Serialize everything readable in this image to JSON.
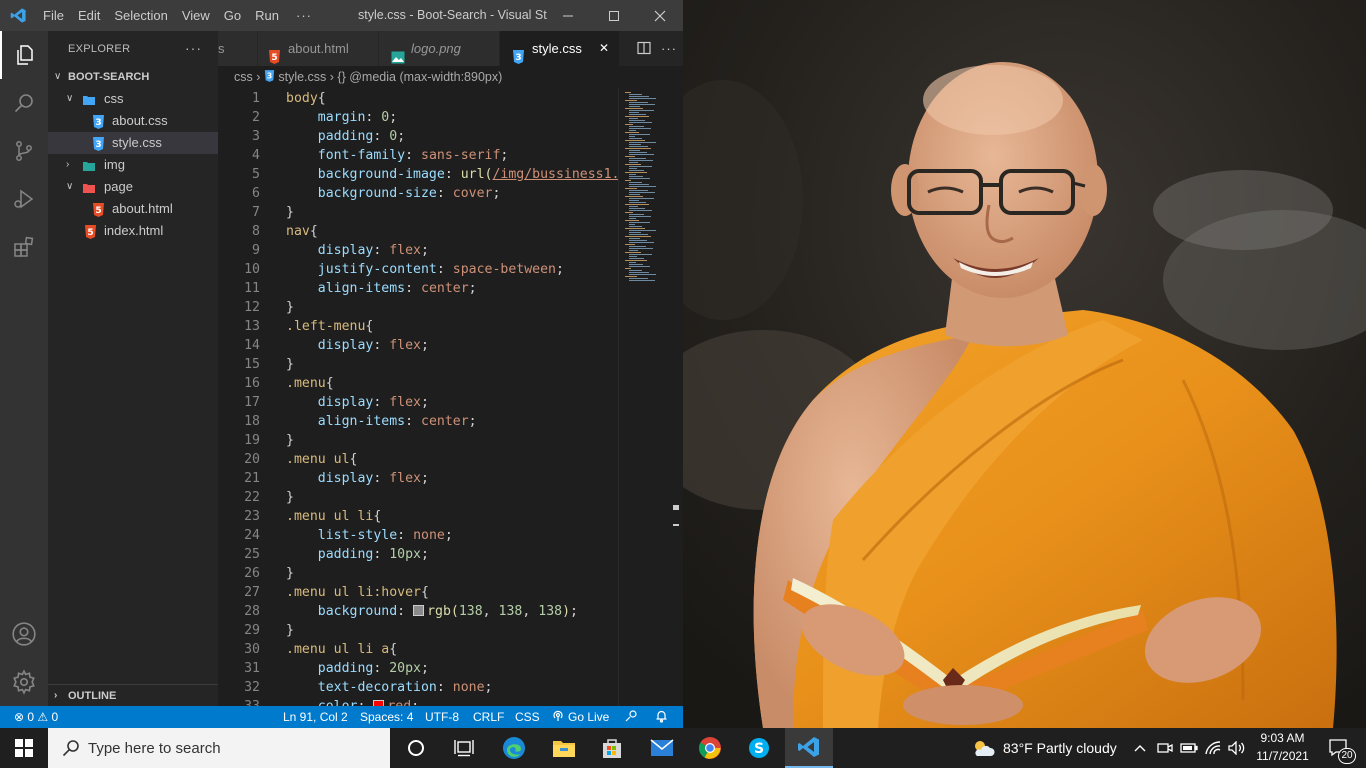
{
  "window": {
    "title": "style.css - Boot-Search - Visual St...",
    "menu": [
      "File",
      "Edit",
      "Selection",
      "View",
      "Go",
      "Run",
      "···"
    ]
  },
  "sidebar": {
    "header": "EXPLORER",
    "more": "···",
    "project": "BOOT-SEARCH",
    "tree": [
      {
        "label": "css",
        "type": "folder",
        "open": true
      },
      {
        "label": "about.css",
        "type": "css"
      },
      {
        "label": "style.css",
        "type": "css",
        "selected": true
      },
      {
        "label": "img",
        "type": "folder",
        "open": false
      },
      {
        "label": "page",
        "type": "folder",
        "open": true
      },
      {
        "label": "about.html",
        "type": "html"
      },
      {
        "label": "index.html",
        "type": "html"
      }
    ],
    "outline": "OUTLINE"
  },
  "tabs": [
    {
      "label": "s",
      "partial": true
    },
    {
      "label": "about.html",
      "icon": "html5-icon"
    },
    {
      "label": "logo.png",
      "icon": "image-icon",
      "italic": true
    },
    {
      "label": "style.css",
      "icon": "css3-icon",
      "active": true,
      "close": "✕"
    }
  ],
  "breadcrumb": {
    "folder": "css",
    "file": "style.css",
    "symbol": "{} @media (max-width:890px)"
  },
  "code_lines": [
    {
      "n": "1",
      "parts": [
        [
          "sel-t",
          "body"
        ],
        [
          "",
          "{"
        ]
      ]
    },
    {
      "n": "2",
      "parts": [
        [
          "",
          "    "
        ],
        [
          "prop",
          "margin"
        ],
        [
          "",
          ": "
        ],
        [
          "num",
          "0"
        ],
        [
          "",
          ";"
        ]
      ]
    },
    {
      "n": "3",
      "parts": [
        [
          "",
          "    "
        ],
        [
          "prop",
          "padding"
        ],
        [
          "",
          ": "
        ],
        [
          "num",
          "0"
        ],
        [
          "",
          ";"
        ]
      ]
    },
    {
      "n": "4",
      "parts": [
        [
          "",
          "    "
        ],
        [
          "prop",
          "font-family"
        ],
        [
          "",
          ": "
        ],
        [
          "val",
          "sans-serif"
        ],
        [
          "",
          ";"
        ]
      ]
    },
    {
      "n": "5",
      "parts": [
        [
          "",
          "    "
        ],
        [
          "prop",
          "background-image"
        ],
        [
          "",
          ": "
        ],
        [
          "fn",
          "url("
        ],
        [
          "url",
          "/img/bussiness1.j"
        ]
      ]
    },
    {
      "n": "6",
      "parts": [
        [
          "",
          "    "
        ],
        [
          "prop",
          "background-size"
        ],
        [
          "",
          ": "
        ],
        [
          "val",
          "cover"
        ],
        [
          "",
          ";"
        ]
      ]
    },
    {
      "n": "7",
      "parts": [
        [
          "",
          "}"
        ]
      ]
    },
    {
      "n": "8",
      "parts": [
        [
          "sel-t",
          "nav"
        ],
        [
          "",
          "{"
        ]
      ]
    },
    {
      "n": "9",
      "parts": [
        [
          "",
          "    "
        ],
        [
          "prop",
          "display"
        ],
        [
          "",
          ": "
        ],
        [
          "val",
          "flex"
        ],
        [
          "",
          ";"
        ]
      ]
    },
    {
      "n": "10",
      "parts": [
        [
          "",
          "    "
        ],
        [
          "prop",
          "justify-content"
        ],
        [
          "",
          ": "
        ],
        [
          "val",
          "space-between"
        ],
        [
          "",
          ";"
        ]
      ]
    },
    {
      "n": "11",
      "parts": [
        [
          "",
          "    "
        ],
        [
          "prop",
          "align-items"
        ],
        [
          "",
          ": "
        ],
        [
          "val",
          "center"
        ],
        [
          "",
          ";"
        ]
      ]
    },
    {
      "n": "12",
      "parts": [
        [
          "",
          "}"
        ]
      ]
    },
    {
      "n": "13",
      "parts": [
        [
          "sel-t",
          ".left-menu"
        ],
        [
          "",
          "{"
        ]
      ]
    },
    {
      "n": "14",
      "parts": [
        [
          "",
          "    "
        ],
        [
          "prop",
          "display"
        ],
        [
          "",
          ": "
        ],
        [
          "val",
          "flex"
        ],
        [
          "",
          ";"
        ]
      ]
    },
    {
      "n": "15",
      "parts": [
        [
          "",
          "}"
        ]
      ]
    },
    {
      "n": "16",
      "parts": [
        [
          "sel-t",
          ".menu"
        ],
        [
          "",
          "{"
        ]
      ]
    },
    {
      "n": "17",
      "parts": [
        [
          "",
          "    "
        ],
        [
          "prop",
          "display"
        ],
        [
          "",
          ": "
        ],
        [
          "val",
          "flex"
        ],
        [
          "",
          ";"
        ]
      ]
    },
    {
      "n": "18",
      "parts": [
        [
          "",
          "    "
        ],
        [
          "prop",
          "align-items"
        ],
        [
          "",
          ": "
        ],
        [
          "val",
          "center"
        ],
        [
          "",
          ";"
        ]
      ]
    },
    {
      "n": "19",
      "parts": [
        [
          "",
          "}"
        ]
      ]
    },
    {
      "n": "20",
      "parts": [
        [
          "sel-t",
          ".menu ul"
        ],
        [
          "",
          "{"
        ]
      ]
    },
    {
      "n": "21",
      "parts": [
        [
          "",
          "    "
        ],
        [
          "prop",
          "display"
        ],
        [
          "",
          ": "
        ],
        [
          "val",
          "flex"
        ],
        [
          "",
          ";"
        ]
      ]
    },
    {
      "n": "22",
      "parts": [
        [
          "",
          "}"
        ]
      ]
    },
    {
      "n": "23",
      "parts": [
        [
          "sel-t",
          ".menu ul li"
        ],
        [
          "",
          "{"
        ]
      ]
    },
    {
      "n": "24",
      "parts": [
        [
          "",
          "    "
        ],
        [
          "prop",
          "list-style"
        ],
        [
          "",
          ": "
        ],
        [
          "val",
          "none"
        ],
        [
          "",
          ";"
        ]
      ]
    },
    {
      "n": "25",
      "parts": [
        [
          "",
          "    "
        ],
        [
          "prop",
          "padding"
        ],
        [
          "",
          ": "
        ],
        [
          "num",
          "10px"
        ],
        [
          "",
          ";"
        ]
      ]
    },
    {
      "n": "26",
      "parts": [
        [
          "",
          "}"
        ]
      ]
    },
    {
      "n": "27",
      "parts": [
        [
          "sel-t",
          ".menu ul li:hover"
        ],
        [
          "",
          "{"
        ]
      ]
    },
    {
      "n": "28",
      "parts": [
        [
          "",
          "    "
        ],
        [
          "prop",
          "background"
        ],
        [
          "",
          ": "
        ],
        [
          "swatch:#8a8a8a",
          ""
        ],
        [
          "fn",
          "rgb("
        ],
        [
          "num",
          "138"
        ],
        [
          "",
          ", "
        ],
        [
          "num",
          "138"
        ],
        [
          "",
          ", "
        ],
        [
          "num",
          "138"
        ],
        [
          "fn",
          ")"
        ],
        [
          "",
          ";"
        ]
      ]
    },
    {
      "n": "29",
      "parts": [
        [
          "",
          "}"
        ]
      ]
    },
    {
      "n": "30",
      "parts": [
        [
          "sel-t",
          ".menu ul li a"
        ],
        [
          "",
          "{"
        ]
      ]
    },
    {
      "n": "31",
      "parts": [
        [
          "",
          "    "
        ],
        [
          "prop",
          "padding"
        ],
        [
          "",
          ": "
        ],
        [
          "num",
          "20px"
        ],
        [
          "",
          ";"
        ]
      ]
    },
    {
      "n": "32",
      "parts": [
        [
          "",
          "    "
        ],
        [
          "prop",
          "text-decoration"
        ],
        [
          "",
          ": "
        ],
        [
          "val",
          "none"
        ],
        [
          "",
          ";"
        ]
      ]
    },
    {
      "n": "33",
      "parts": [
        [
          "",
          "    "
        ],
        [
          "prop",
          "color"
        ],
        [
          "",
          ": "
        ],
        [
          "swatch:#ff0000",
          ""
        ],
        [
          "val",
          "red"
        ],
        [
          "",
          ";"
        ]
      ]
    }
  ],
  "status": {
    "problems": "⊗ 0 ⚠ 0",
    "position": "Ln 91, Col 2",
    "spaces": "Spaces: 4",
    "encoding": "UTF-8",
    "eol": "CRLF",
    "language": "CSS",
    "golive": "Go Live"
  },
  "taskbar": {
    "search_placeholder": "Type here to search",
    "weather": "83°F  Partly cloudy",
    "time": "9:03 AM",
    "date": "11/7/2021",
    "notifications": "20"
  },
  "colors": {
    "accent": "#007acc",
    "activity": "#333333",
    "sidebar": "#252526",
    "editor": "#1e1e1e",
    "robe": "#e8901a"
  }
}
